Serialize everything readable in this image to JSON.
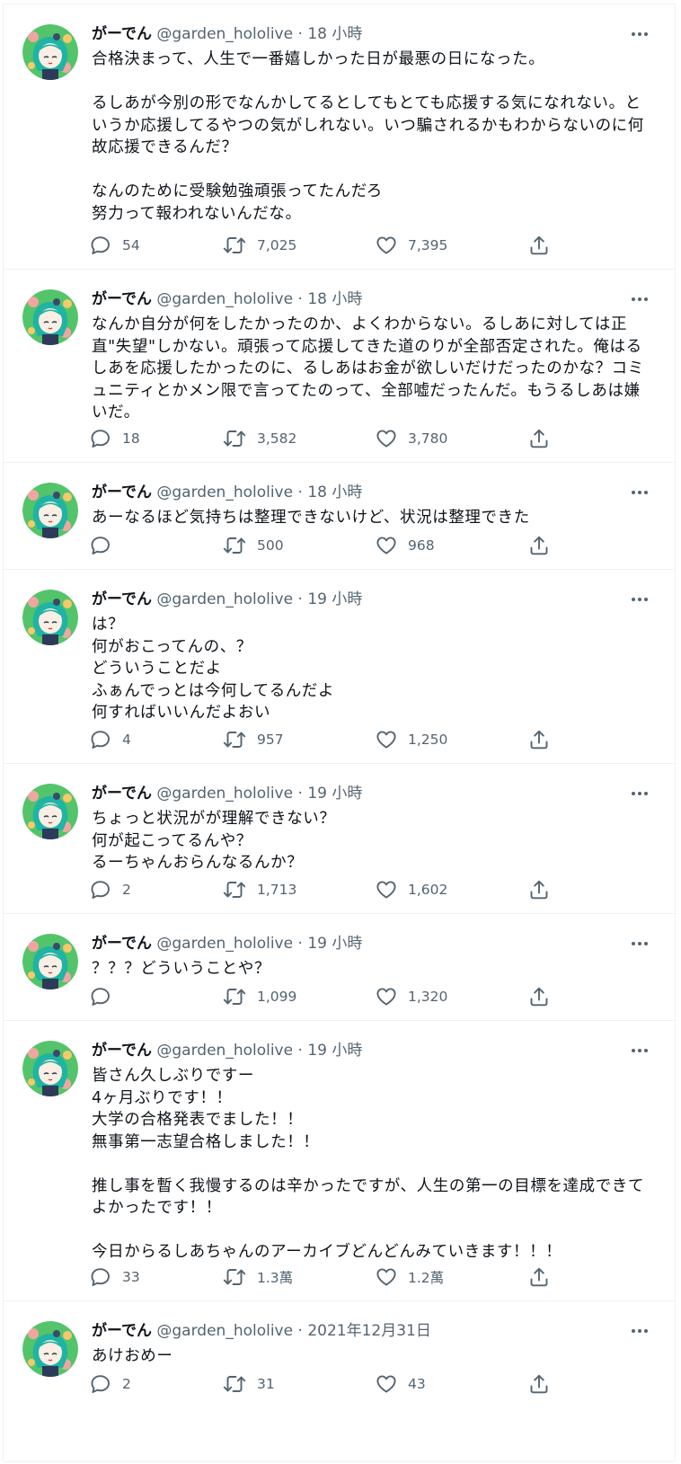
{
  "colors": {
    "text_primary": "#0f1419",
    "text_secondary": "#536471",
    "divider": "#eff3f4",
    "background": "#ffffff"
  },
  "icons": {
    "reply": "reply-icon",
    "retweet": "retweet-icon",
    "like": "like-icon",
    "share": "share-icon",
    "more": "more-icon"
  },
  "tweets": [
    {
      "name": "がーでん",
      "handle": "@garden_hololive",
      "dot": "·",
      "time": "18 小時",
      "text": "合格決まって、人生で一番嬉しかった日が最悪の日になった。\n\nるしあが今別の形でなんかしてるとしてもとても応援する気になれない。というか応援してるやつの気がしれない。いつ騙されるかもわからないのに何故応援できるんだ？\n\nなんのために受験勉強頑張ってたんだろ\n努力って報われないんだな。",
      "replies": "54",
      "retweets": "7,025",
      "likes": "7,395"
    },
    {
      "name": "がーでん",
      "handle": "@garden_hololive",
      "dot": "·",
      "time": "18 小時",
      "text": "なんか自分が何をしたかったのか、よくわからない。るしあに対しては正直\"失望\"しかない。頑張って応援してきた道のりが全部否定された。俺はるしあを応援したかったのに、るしあはお金が欲しいだけだったのかな？コミュニティとかメン限で言ってたのって、全部嘘だったんだ。もうるしあは嫌いだ。",
      "replies": "18",
      "retweets": "3,582",
      "likes": "3,780"
    },
    {
      "name": "がーでん",
      "handle": "@garden_hololive",
      "dot": "·",
      "time": "18 小時",
      "text": "あーなるほど気持ちは整理できないけど、状況は整理できた",
      "replies": "",
      "retweets": "500",
      "likes": "968"
    },
    {
      "name": "がーでん",
      "handle": "@garden_hololive",
      "dot": "·",
      "time": "19 小時",
      "text": "は？\n何がおこってんの、？\nどういうことだよ\nふぁんでっとは今何してるんだよ\n何すればいいんだよおい",
      "replies": "4",
      "retweets": "957",
      "likes": "1,250"
    },
    {
      "name": "がーでん",
      "handle": "@garden_hololive",
      "dot": "·",
      "time": "19 小時",
      "text": "ちょっと状況がが理解できない？\n何が起こってるんや？\nるーちゃんおらんなるんか？",
      "replies": "2",
      "retweets": "1,713",
      "likes": "1,602"
    },
    {
      "name": "がーでん",
      "handle": "@garden_hololive",
      "dot": "·",
      "time": "19 小時",
      "text": "？？？どういうことや？",
      "replies": "",
      "retweets": "1,099",
      "likes": "1,320"
    },
    {
      "name": "がーでん",
      "handle": "@garden_hololive",
      "dot": "·",
      "time": "19 小時",
      "text": "皆さん久しぶりですー\n4ヶ月ぶりです！！\n大学の合格発表でました！！\n無事第一志望合格しました！！\n\n推し事を暫く我慢するのは辛かったですが、人生の第一の目標を達成できてよかったです！！\n\n今日からるしあちゃんのアーカイブどんどんみていきます！！！",
      "replies": "33",
      "retweets": "1.3萬",
      "likes": "1.2萬"
    },
    {
      "name": "がーでん",
      "handle": "@garden_hololive",
      "dot": "·",
      "time": "2021年12月31日",
      "text": "あけおめー",
      "replies": "2",
      "retweets": "31",
      "likes": "43"
    }
  ]
}
